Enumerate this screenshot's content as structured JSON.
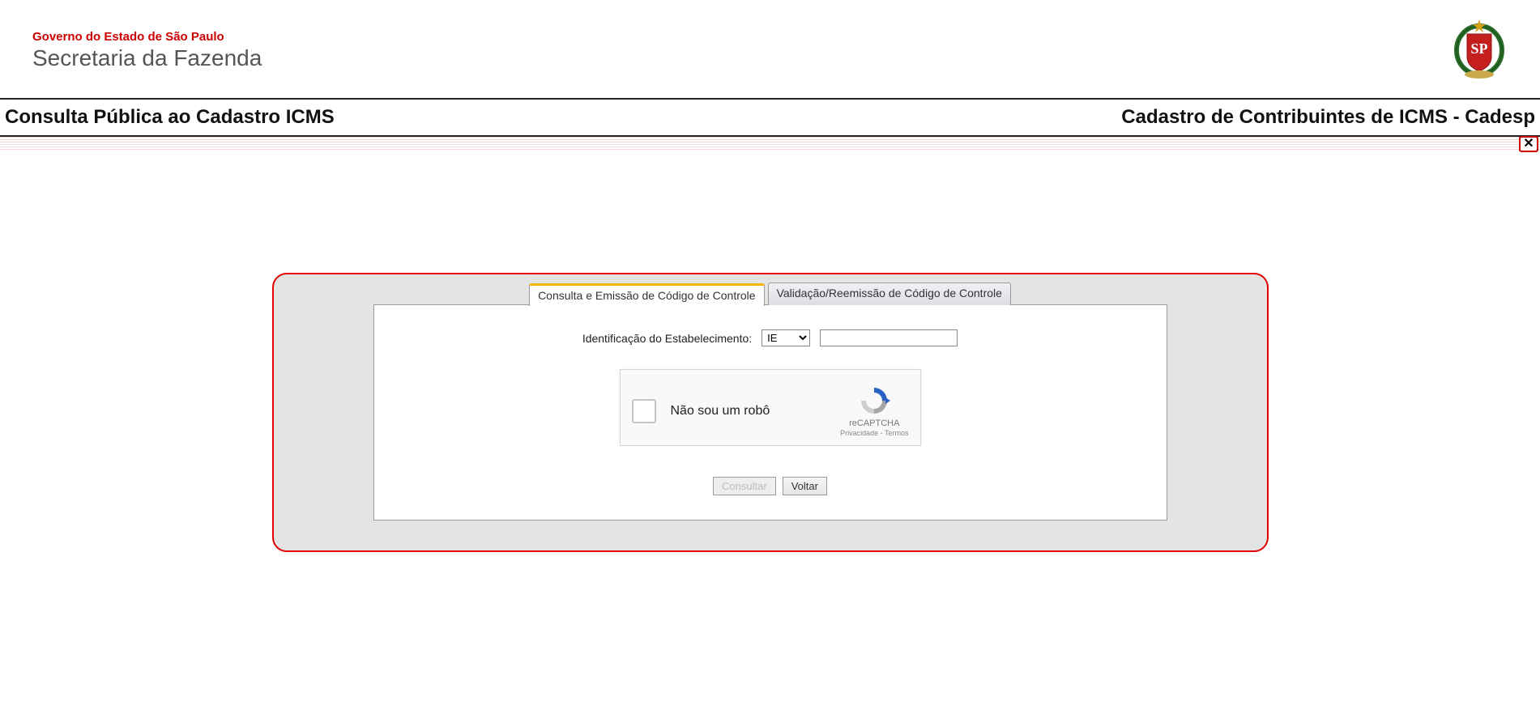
{
  "header": {
    "gov_line": "Governo do Estado de São Paulo",
    "sec_line": "Secretaria da Fazenda"
  },
  "title_bar": {
    "left": "Consulta Pública ao Cadastro ICMS",
    "right": "Cadastro de Contribuintes de ICMS - Cadesp"
  },
  "close_button": {
    "symbol": "✕"
  },
  "tabs": {
    "active": "Consulta e Emissão de Código de Controle",
    "inactive": "Validação/Reemissão de Código de Controle"
  },
  "form": {
    "label": "Identificação do Estabelecimento:",
    "select_value": "IE",
    "input_value": ""
  },
  "recaptcha": {
    "text": "Não sou um robô",
    "brand": "reCAPTCHA",
    "privacy": "Privacidade",
    "sep": " - ",
    "terms": "Termos"
  },
  "buttons": {
    "consultar": "Consultar",
    "voltar": "Voltar"
  }
}
